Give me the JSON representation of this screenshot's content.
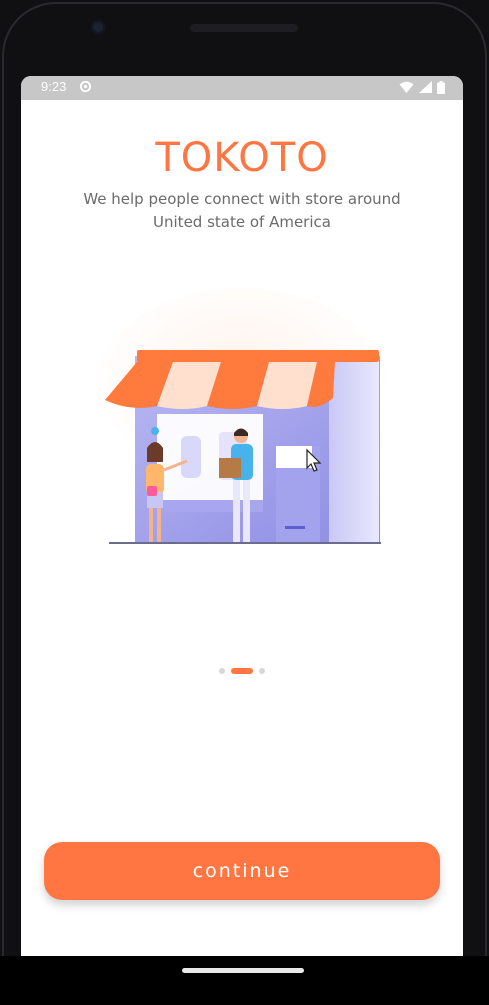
{
  "status_bar": {
    "time": "9:23",
    "icons": [
      "settings-icon",
      "wifi-icon",
      "signal-icon",
      "battery-icon"
    ]
  },
  "onboarding": {
    "app_name": "TOKOTO",
    "tagline": "We help people connect with store around United state of America",
    "illustration": "store-illustration",
    "page_indicator": {
      "total": 3,
      "active_index": 1
    },
    "continue_label": "continue"
  },
  "colors": {
    "accent": "#ff7643",
    "text_secondary": "#6b6b6b",
    "dot_inactive": "#d8d8d8",
    "status_bar_bg": "#c7c7c7"
  }
}
